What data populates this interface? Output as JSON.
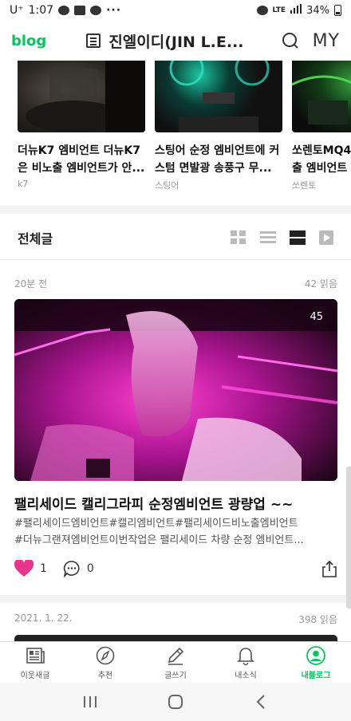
{
  "status_bar": {
    "carrier": "U⁺",
    "time": "1:07",
    "dots": "···",
    "network": "LTE",
    "battery": "34%"
  },
  "header": {
    "logo": "blog",
    "title": "진엘이디(JIN L.E...",
    "my_label": "MY"
  },
  "carousel": [
    {
      "title_line1": "더뉴K7 엠비언트 더뉴K7",
      "title_line2": "은 비노출 엠비언트가 안...",
      "tag": "k7"
    },
    {
      "title_line1": "스팅어 순정 엠비언트에 커",
      "title_line2": "스텀  면발광 송풍구 무...",
      "tag": "스팅어"
    },
    {
      "title_line1": "쏘렌토MQ4",
      "title_line2": "출 엠비언트",
      "tag": "쏘렌토"
    }
  ],
  "section": {
    "title": "전체글"
  },
  "post": {
    "time": "20분 전",
    "reads": "42 읽음",
    "image_count": "45",
    "title": "팰리세이드 캘리그라피 순정엠비언트 광량업 ~~",
    "tags_line1": "#팰리세이드엠비언트#캘리엠비언트#팰리세이드비노출엠비언트",
    "tags_line2": "#더뉴그랜져엠비언트이번작업은 팰리세이드 차량 순정 엠비언트...",
    "likes": "1",
    "comments": "0"
  },
  "post2": {
    "date": "2021. 1. 22.",
    "reads": "398 읽음"
  },
  "bottom_nav": [
    {
      "label": "이웃새글",
      "icon": "news-icon"
    },
    {
      "label": "추천",
      "icon": "compass-icon"
    },
    {
      "label": "글쓰기",
      "icon": "pencil-icon"
    },
    {
      "label": "내소식",
      "icon": "bell-icon"
    },
    {
      "label": "내블로그",
      "icon": "profile-icon",
      "active": true
    }
  ],
  "colors": {
    "brand": "#03c75a",
    "heart": "#e8358c"
  }
}
